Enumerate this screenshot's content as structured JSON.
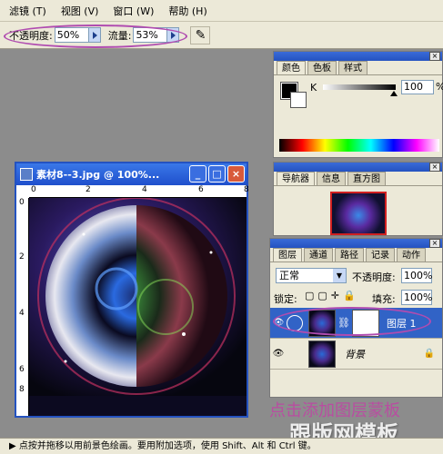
{
  "menu": [
    "滤镜 (T)",
    "视图 (V)",
    "窗口 (W)",
    "帮助 (H)"
  ],
  "options": {
    "opacity_label": "不透明度:",
    "opacity_value": "50%",
    "flow_label": "流量:",
    "flow_value": "53%"
  },
  "color_panel": {
    "tabs": [
      "颜色",
      "色板",
      "样式"
    ],
    "channel_label": "K",
    "channel_value": "100",
    "channel_unit": "%"
  },
  "navigator_panel": {
    "tabs": [
      "导航器",
      "信息",
      "直方图"
    ]
  },
  "document": {
    "title": "素材8--3.jpg @ 100%...",
    "ruler_h": [
      "0",
      "2",
      "4",
      "6",
      "8"
    ],
    "ruler_v": [
      "0",
      "2",
      "4",
      "6",
      "8"
    ]
  },
  "layers_panel": {
    "tabs": [
      "图层",
      "通道",
      "路径",
      "记录",
      "动作"
    ],
    "blend_mode": "正常",
    "opacity_label": "不透明度:",
    "opacity_value": "100%",
    "lock_label": "锁定:",
    "fill_label": "填充:",
    "fill_value": "100%",
    "layers": [
      {
        "name": "图层 1"
      },
      {
        "name": "背景"
      }
    ]
  },
  "annotation": "点击添加图层蒙板",
  "watermark": "跟版网模板",
  "status": "点按并拖移以用前景色绘画。要用附加选项，使用 Shift、Alt 和 Ctrl 键。"
}
